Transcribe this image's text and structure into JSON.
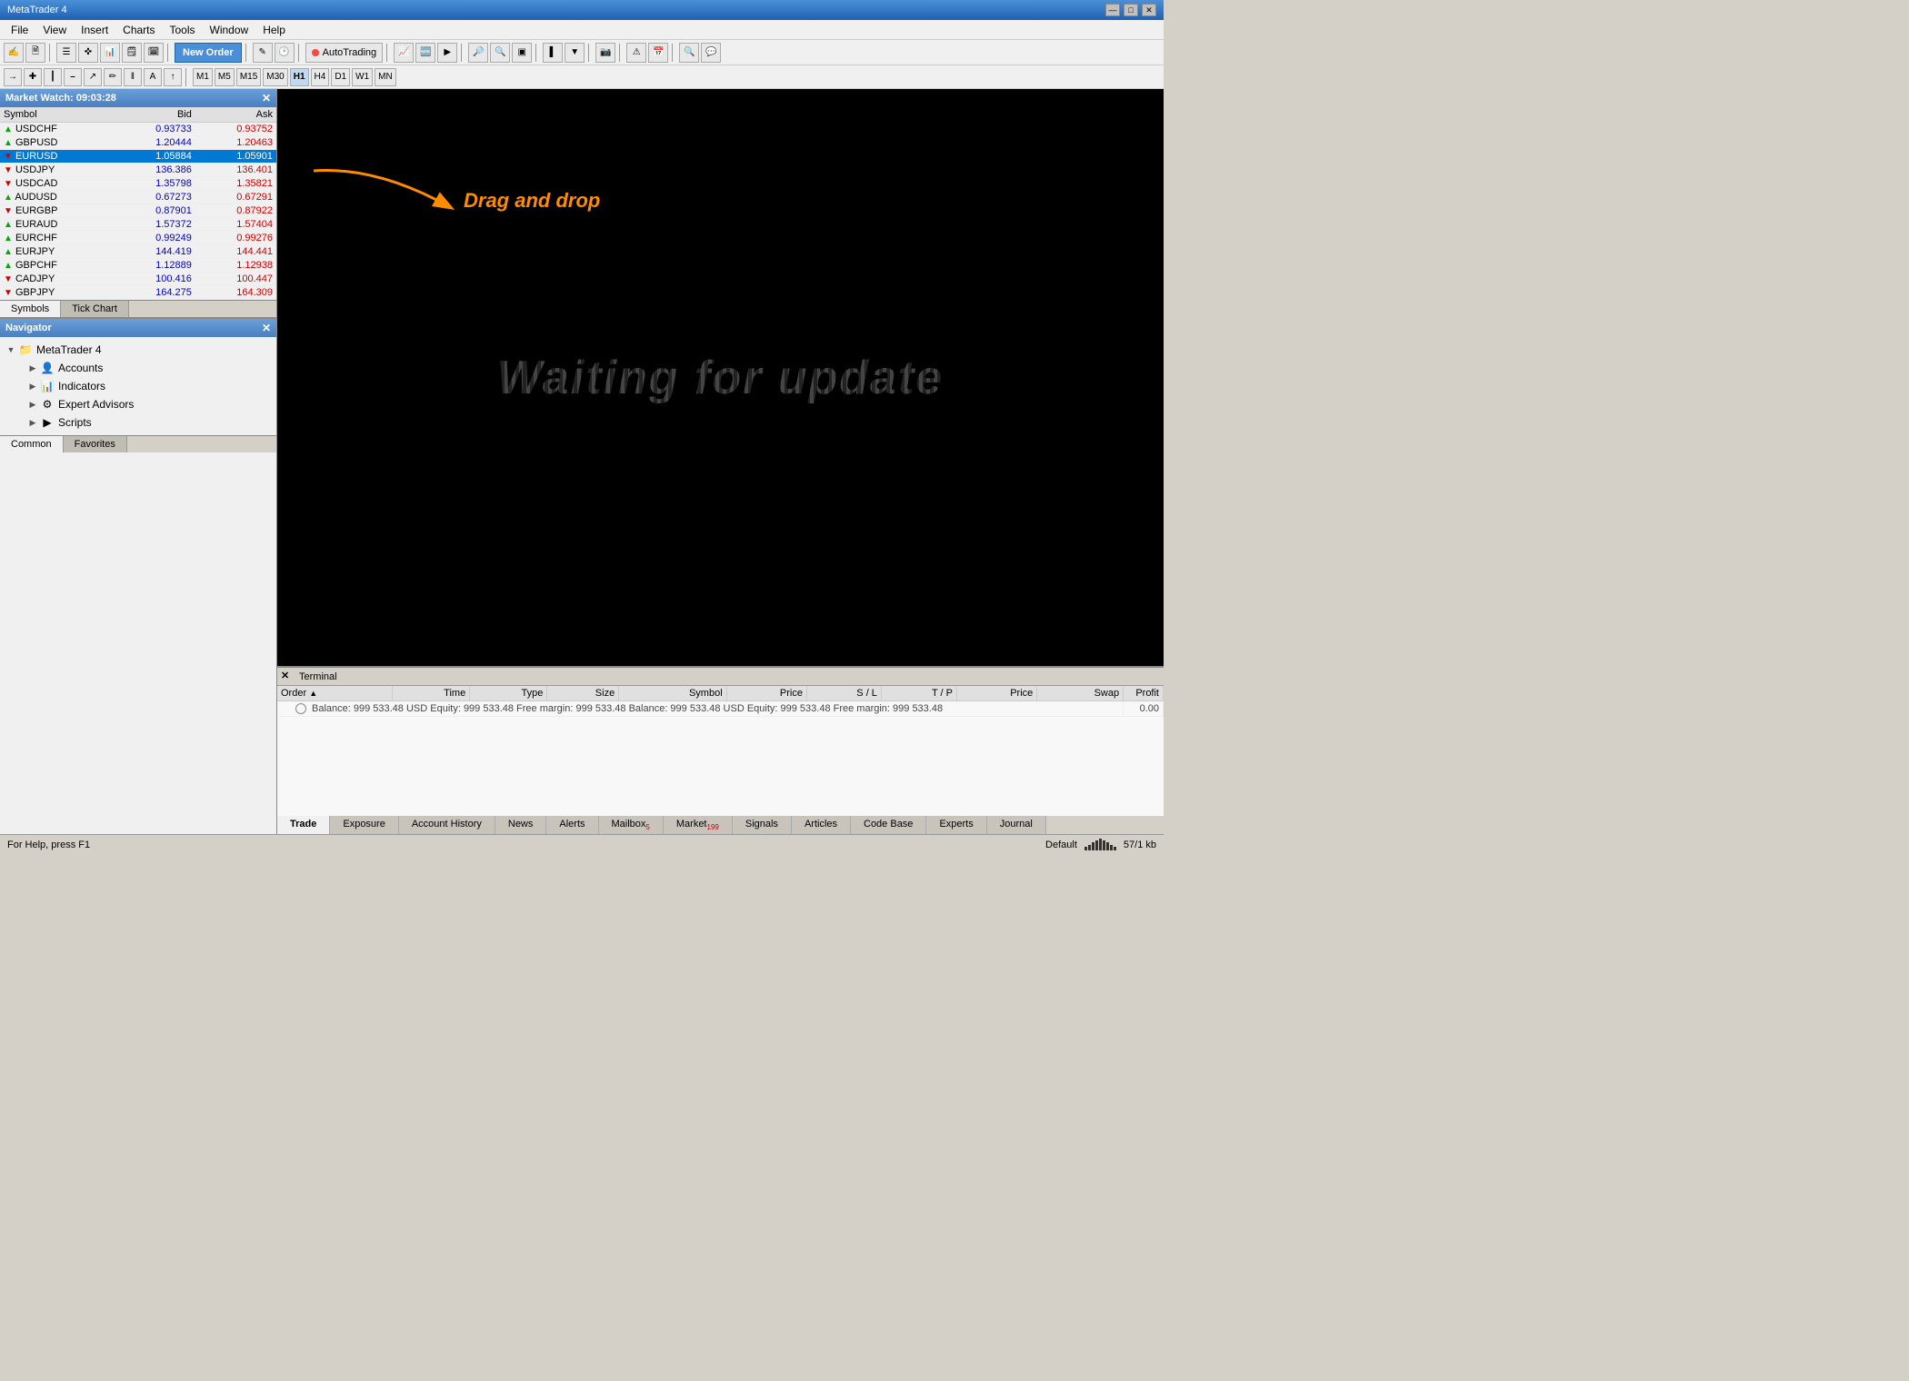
{
  "window": {
    "title": "MetaTrader 4",
    "title_bar_label": "MetaTrader 4"
  },
  "menu": {
    "items": [
      "File",
      "View",
      "Insert",
      "Charts",
      "Tools",
      "Window",
      "Help"
    ]
  },
  "toolbar1": {
    "new_order_label": "New Order",
    "autotrading_label": "AutoTrading",
    "timeframes": [
      "M1",
      "M5",
      "M15",
      "M30",
      "H1",
      "H4",
      "D1",
      "W1",
      "MN"
    ]
  },
  "market_watch": {
    "title": "Market Watch: 09:03:28",
    "columns": [
      "Symbol",
      "Bid",
      "Ask"
    ],
    "symbols": [
      {
        "name": "USDCHF",
        "bid": "0.93733",
        "ask": "0.93752",
        "up": true
      },
      {
        "name": "GBPUSD",
        "bid": "1.20444",
        "ask": "1.20463",
        "up": true
      },
      {
        "name": "EURUSD",
        "bid": "1.05884",
        "ask": "1.05901",
        "up": false,
        "selected": true
      },
      {
        "name": "USDJPY",
        "bid": "136.386",
        "ask": "136.401",
        "up": false
      },
      {
        "name": "USDCAD",
        "bid": "1.35798",
        "ask": "1.35821",
        "up": false
      },
      {
        "name": "AUDUSD",
        "bid": "0.67273",
        "ask": "0.67291",
        "up": true
      },
      {
        "name": "EURGBP",
        "bid": "0.87901",
        "ask": "0.87922",
        "up": false
      },
      {
        "name": "EURAUD",
        "bid": "1.57372",
        "ask": "1.57404",
        "up": true
      },
      {
        "name": "EURCHF",
        "bid": "0.99249",
        "ask": "0.99276",
        "up": true
      },
      {
        "name": "EURJPY",
        "bid": "144.419",
        "ask": "144.441",
        "up": true
      },
      {
        "name": "GBPCHF",
        "bid": "1.12889",
        "ask": "1.12938",
        "up": true
      },
      {
        "name": "CADJPY",
        "bid": "100.416",
        "ask": "100.447",
        "up": false
      },
      {
        "name": "GBPJPY",
        "bid": "164.275",
        "ask": "164.309",
        "up": false
      }
    ],
    "tabs": [
      "Symbols",
      "Tick Chart"
    ]
  },
  "navigator": {
    "title": "Navigator",
    "tree": [
      {
        "label": "MetaTrader 4",
        "icon": "folder",
        "expanded": true,
        "children": [
          {
            "label": "Accounts",
            "icon": "accounts",
            "expanded": false
          },
          {
            "label": "Indicators",
            "icon": "indicators",
            "expanded": false
          },
          {
            "label": "Expert Advisors",
            "icon": "experts",
            "expanded": false
          },
          {
            "label": "Scripts",
            "icon": "scripts",
            "expanded": false
          }
        ]
      }
    ],
    "tabs": [
      "Common",
      "Favorites"
    ]
  },
  "chart": {
    "drag_text": "Drag and drop",
    "waiting_text": "Waiting for update"
  },
  "terminal": {
    "columns": [
      "Order",
      "Time",
      "Type",
      "Size",
      "Symbol",
      "Price",
      "S / L",
      "T / P",
      "Price",
      "Swap",
      "Profit"
    ],
    "balance_row": "Balance: 999 533.48 USD   Equity: 999 533.48   Free margin: 999 533.48",
    "balance_profit": "0.00",
    "tabs": [
      {
        "label": "Trade",
        "active": true
      },
      {
        "label": "Exposure"
      },
      {
        "label": "Account History"
      },
      {
        "label": "News"
      },
      {
        "label": "Alerts"
      },
      {
        "label": "Mailbox",
        "badge": "5"
      },
      {
        "label": "Market",
        "badge": "199"
      },
      {
        "label": "Signals"
      },
      {
        "label": "Articles"
      },
      {
        "label": "Code Base"
      },
      {
        "label": "Experts"
      },
      {
        "label": "Journal"
      }
    ]
  },
  "status_bar": {
    "help_text": "For Help, press F1",
    "profile": "Default",
    "chart_info": "57/1 kb"
  }
}
